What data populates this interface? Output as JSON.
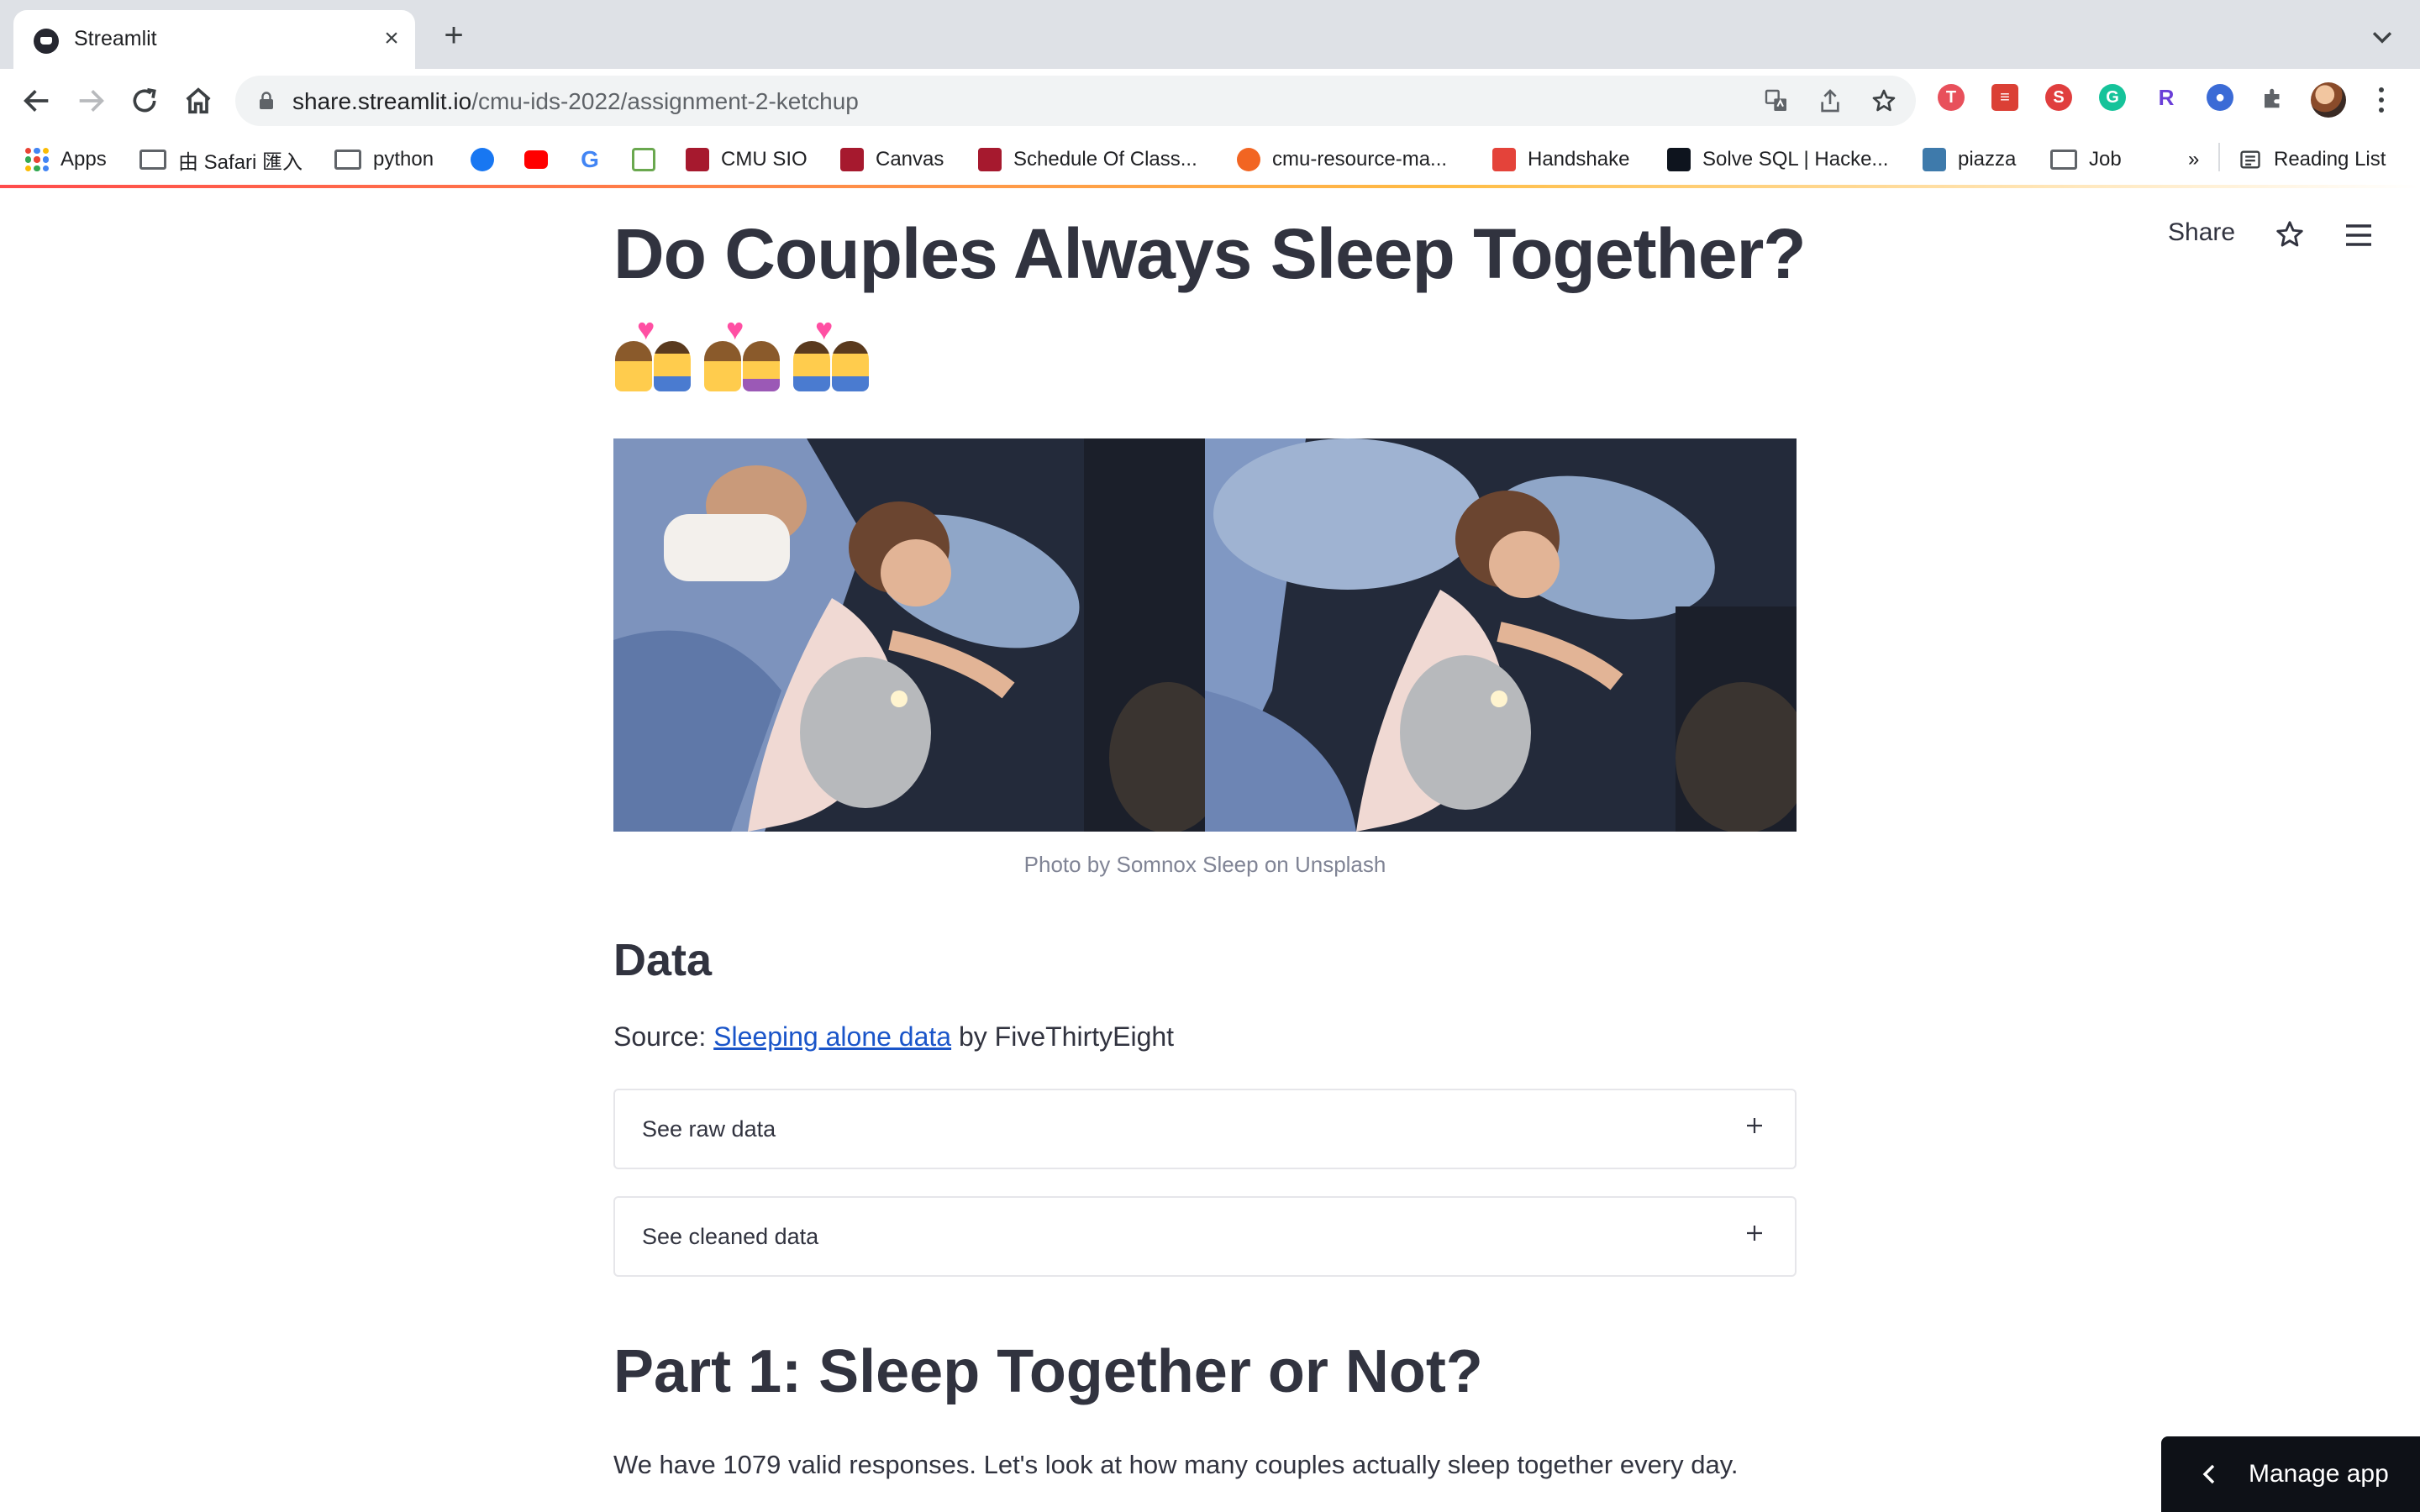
{
  "browser": {
    "tab_title": "Streamlit",
    "url_host": "share.streamlit.io",
    "url_path": "/cmu-ids-2022/assignment-2-ketchup",
    "bookmarks": [
      {
        "label": "Apps"
      },
      {
        "label": "由 Safari 匯入"
      },
      {
        "label": "python"
      },
      {
        "label": "CMU SIO"
      },
      {
        "label": "Canvas"
      },
      {
        "label": "Schedule Of Class..."
      },
      {
        "label": "cmu-resource-ma..."
      },
      {
        "label": "Handshake"
      },
      {
        "label": "Solve SQL | Hacke..."
      },
      {
        "label": "piazza"
      },
      {
        "label": "Job"
      }
    ],
    "bookmarks_overflow": "»",
    "reading_list": "Reading List"
  },
  "app": {
    "header": {
      "share_label": "Share"
    },
    "title": "Do Couples Always Sleep Together?",
    "emoji_icons": [
      "couple-with-heart-woman-man-icon",
      "couple-with-heart-woman-woman-icon",
      "couple-with-heart-man-man-icon"
    ],
    "photo_caption": "Photo by Somnox Sleep on Unsplash",
    "data_section": {
      "heading": "Data",
      "source_prefix": "Source: ",
      "source_link": "Sleeping alone data",
      "source_suffix": " by FiveThirtyEight"
    },
    "expanders": [
      {
        "label": "See raw data"
      },
      {
        "label": "See cleaned data"
      }
    ],
    "part1": {
      "heading": "Part 1: Sleep Together or Not?",
      "text": "We have 1079 valid responses. Let's look at how many couples actually sleep together every day."
    },
    "manage_app": "Manage app"
  },
  "colors": {
    "streamlit_text": "#31333f",
    "link": "#1a55c9",
    "caption": "#808495",
    "manage_bg": "#0e1117"
  }
}
